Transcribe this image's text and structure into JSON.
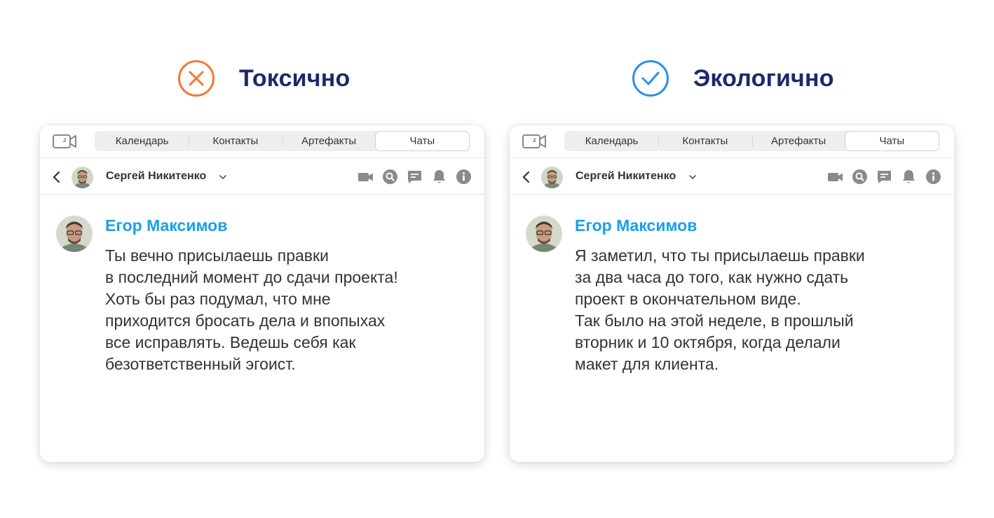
{
  "toxic": {
    "heading": "Токсично",
    "icon": "x-circle-icon",
    "accent": "#f07a35",
    "tabs": [
      "Календарь",
      "Контакты",
      "Артефакты",
      "Чаты"
    ],
    "active_tab": "Чаты",
    "contact_name": "Сергей Никитенко",
    "message": {
      "sender": "Егор Максимов",
      "lines": [
        "Ты вечно присылаешь правки",
        "в последний момент до сдачи проекта!",
        "Хоть бы раз подумал, что мне",
        "приходится бросать дела и впопыхах",
        "все исправлять. Ведешь себя как",
        "безответственный эгоист."
      ]
    }
  },
  "ecological": {
    "heading": "Экологично",
    "icon": "check-circle-icon",
    "accent": "#2b8ef0",
    "tabs": [
      "Календарь",
      "Контакты",
      "Артефакты",
      "Чаты"
    ],
    "active_tab": "Чаты",
    "contact_name": "Сергей Никитенко",
    "message": {
      "sender": "Егор Максимов",
      "lines": [
        "Я заметил, что ты присылаешь правки",
        "за два часа до того, как нужно сдать",
        "проект в окончательном виде.",
        "Так было на этой неделе, в прошлый",
        "вторник и 10 октября, когда делали",
        "макет для клиента."
      ]
    }
  },
  "colors": {
    "heading_text": "#1c2a6b",
    "sender_name": "#1a9fec",
    "icon_gray": "#8a8a8a"
  }
}
